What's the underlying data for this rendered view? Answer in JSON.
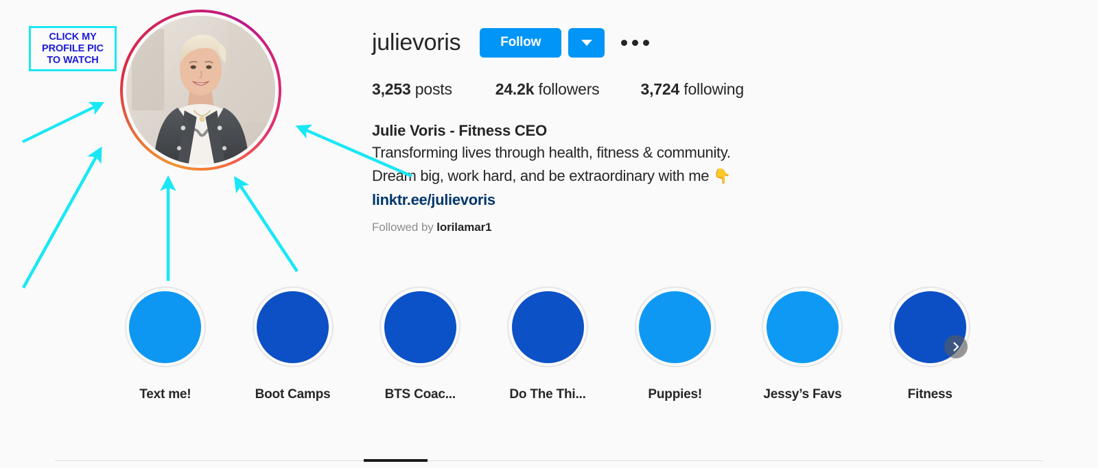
{
  "theme": {
    "background": "#fafafa",
    "text_primary": "#262626",
    "text_muted": "#8e8e8e",
    "accent_blue": "#0095f6",
    "link_blue": "#00376b",
    "annotation_cyan": "#1ae7f5",
    "annotation_blue": "#1b1bd6",
    "divider": "#dbdbdb"
  },
  "annotation": {
    "name": "click-my-profile-pic-callout",
    "lines": [
      "CLICK MY",
      "PROFILE PIC",
      "TO WATCH"
    ],
    "arrow_count": 5,
    "arrow_color": "#1ae7f5"
  },
  "profile": {
    "avatar_alt": "Julie Voris profile photo",
    "has_story_ring": true,
    "username": "julievoris",
    "follow_label": "Follow",
    "more_options_label": "•••",
    "stats": [
      {
        "value": "3,253",
        "label": "posts"
      },
      {
        "value": "24.2k",
        "label": "followers"
      },
      {
        "value": "3,724",
        "label": "following"
      }
    ],
    "full_name": "Julie Voris - Fitness CEO",
    "bio_lines": [
      "Transforming lives through health, fitness & community.",
      "Dream big, work hard, and be extraordinary with me"
    ],
    "bio_emoji": "👇",
    "link": "linktr.ee/julievoris",
    "followed_by_prefix": "Followed by",
    "followed_by_names": "lorilamar1"
  },
  "highlights": {
    "next_icon": "chevron-right-icon",
    "items": [
      {
        "label": "Text me!",
        "color": "#0e97f2"
      },
      {
        "label": "Boot Camps",
        "color": "#0d4fc4"
      },
      {
        "label": "BTS Coac...",
        "color": "#0b52c8"
      },
      {
        "label": "Do The Thi...",
        "color": "#0c51c6"
      },
      {
        "label": "Puppies!",
        "color": "#0f98f3"
      },
      {
        "label": "Jessy’s Favs",
        "color": "#0e9af4"
      },
      {
        "label": "Fitness",
        "color": "#0c4fc5"
      }
    ]
  },
  "tabs": {
    "active_indicator": true
  }
}
